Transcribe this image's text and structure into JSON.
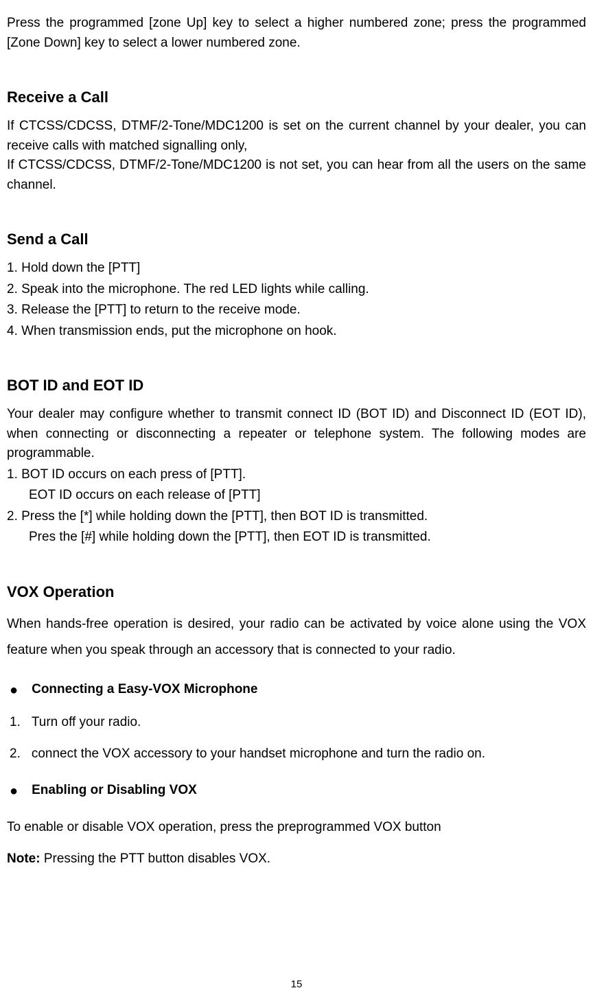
{
  "intro": "Press the programmed [zone Up] key to select a higher numbered zone; press the programmed [Zone Down] key to select a lower numbered zone.",
  "receive": {
    "heading": "Receive a Call",
    "p1": "If CTCSS/CDCSS, DTMF/2-Tone/MDC1200 is set on the current channel by your dealer, you can receive calls with matched signalling only,",
    "p2": "If CTCSS/CDCSS, DTMF/2-Tone/MDC1200 is not set, you can hear from all the users on the same channel."
  },
  "send": {
    "heading": "Send a Call",
    "items": [
      "1. Hold down the [PTT]",
      "2. Speak into the microphone. The red LED lights while calling.",
      "3. Release the [PTT] to return to the receive mode.",
      "4. When transmission ends, put the microphone on hook."
    ]
  },
  "bot": {
    "heading": "BOT ID and EOT ID",
    "p1": "Your dealer may configure whether to transmit connect ID (BOT ID) and Disconnect ID (EOT ID), when connecting or disconnecting a repeater or telephone system. The following modes are programmable.",
    "l1": "1. BOT ID occurs on each press of [PTT].",
    "l1b": "EOT ID occurs on each release of [PTT]",
    "l2": "2. Press the [*] while holding down the [PTT], then BOT ID is transmitted.",
    "l2b": "Pres the [#] while holding down the [PTT], then EOT ID is transmitted."
  },
  "vox": {
    "heading": "VOX Operation",
    "p1": "When hands-free operation is desired, your radio can be activated by voice alone using the VOX feature when you speak through an accessory that is connected to your radio.",
    "sub1": "Connecting a Easy-VOX Microphone",
    "step1_num": "1.",
    "step1": "Turn off your radio.",
    "step2_num": "2.",
    "step2": "connect the VOX accessory to your handset microphone and turn the radio on.",
    "sub2": "Enabling or Disabling VOX",
    "p2": "To enable or disable VOX operation, press the preprogrammed VOX button",
    "note_label": "Note:",
    "note_text": "  Pressing the PTT button disables VOX."
  },
  "page_number": "15",
  "bullet_char": "●"
}
